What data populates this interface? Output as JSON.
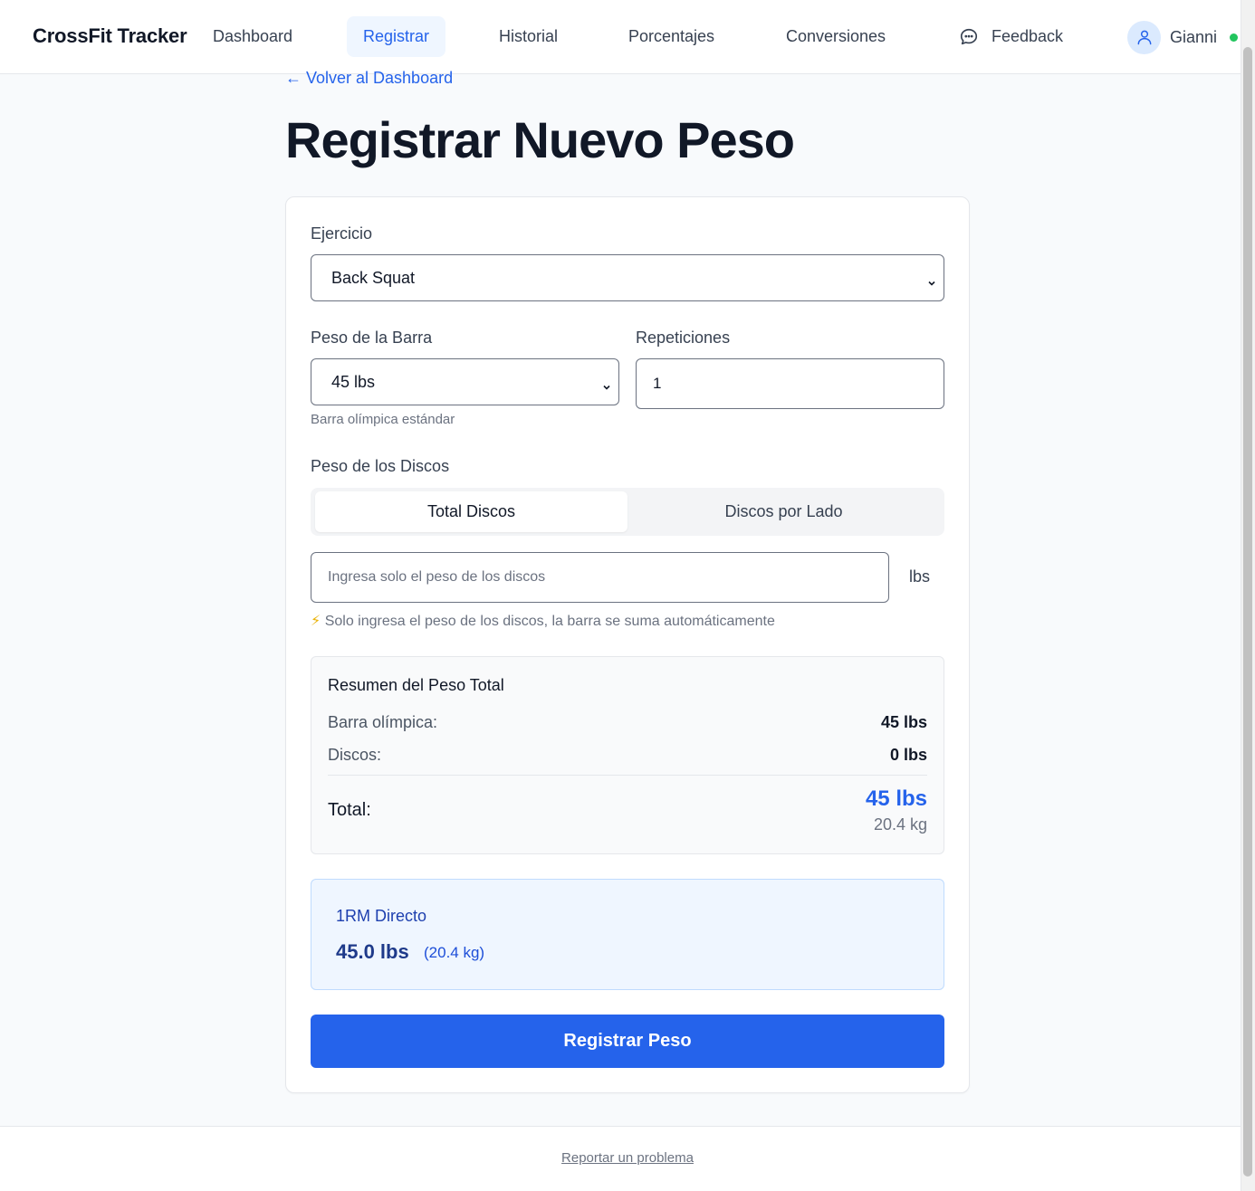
{
  "nav": {
    "brand": "CrossFit Tracker",
    "items": [
      {
        "label": "Dashboard",
        "active": false
      },
      {
        "label": "Registrar",
        "active": true
      },
      {
        "label": "Historial",
        "active": false
      },
      {
        "label": "Porcentajes",
        "active": false
      },
      {
        "label": "Conversiones",
        "active": false
      }
    ],
    "feedback_label": "Feedback",
    "user_name": "Gianni",
    "online_color": "#22c55e"
  },
  "page": {
    "back_link": "← Volver al Dashboard",
    "title": "Registrar Nuevo Peso"
  },
  "form": {
    "exercise_label": "Ejercicio",
    "exercise_value": "Back Squat",
    "bar_label": "Peso de la Barra",
    "bar_value": "45 lbs",
    "bar_hint": "Barra olímpica estándar",
    "reps_label": "Repeticiones",
    "reps_value": "1",
    "plates_label": "Peso de los Discos",
    "tabs": [
      {
        "label": "Total Discos",
        "active": true
      },
      {
        "label": "Discos por Lado",
        "active": false
      }
    ],
    "plates_placeholder": "Ingresa solo el peso de los discos",
    "plates_unit": "lbs",
    "plates_hint_icon": "⚡",
    "plates_hint": "Solo ingresa el peso de los discos, la barra se suma automáticamente"
  },
  "summary": {
    "title": "Resumen del Peso Total",
    "bar_label": "Barra olímpica:",
    "bar_value": "45 lbs",
    "plates_label": "Discos:",
    "plates_value": "0 lbs",
    "total_label": "Total:",
    "total_lbs": "45 lbs",
    "total_kg": "20.4 kg"
  },
  "one_rm": {
    "title": "1RM Directo",
    "value": "45.0 lbs",
    "kg": "(20.4 kg)"
  },
  "submit_label": "Registrar Peso",
  "footer": {
    "link": "Reportar un problema"
  },
  "colors": {
    "accent": "#2563eb",
    "background": "#f8fafc"
  }
}
